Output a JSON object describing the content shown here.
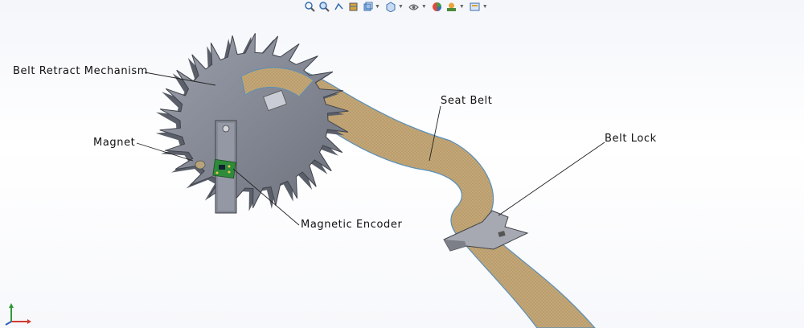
{
  "callouts": {
    "belt_retract": "Belt Retract Mechanism",
    "magnet": "Magnet",
    "seat_belt": "Seat Belt",
    "belt_lock": "Belt Lock",
    "magnetic_encoder": "Magnetic Encoder"
  },
  "colors": {
    "belt": "#c2a676",
    "belt_edge": "#5a8fb8",
    "metal": "#8a8e9a",
    "metal_dark": "#5b5f69",
    "pcb": "#2e8b3a",
    "lock": "#a7a9b2"
  },
  "toolbar": {
    "icons": [
      "zoom-to-fit-icon",
      "zoom-area-icon",
      "previous-view-icon",
      "section-view-icon",
      "view-orientation-icon",
      "display-style-icon",
      "hide-show-icon",
      "edit-appearance-icon",
      "apply-scene-icon",
      "view-settings-icon"
    ]
  }
}
